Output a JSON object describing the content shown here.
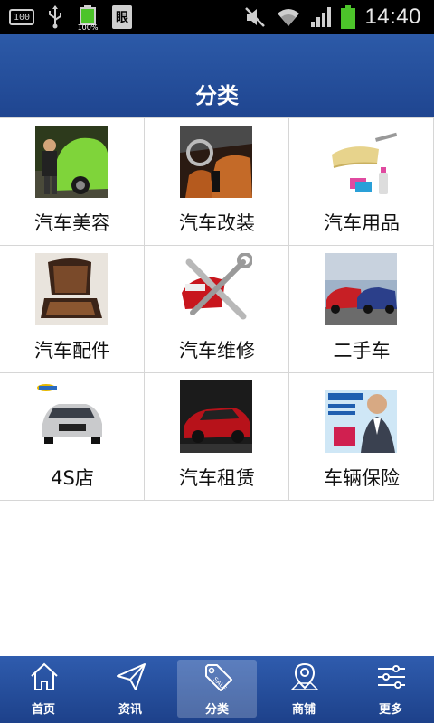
{
  "status_bar": {
    "left_box_text": "100",
    "battery_small_pct": "100%",
    "doc_icon_char": "眼",
    "time": "14:40",
    "icons": [
      "screenshot-icon",
      "usb-icon",
      "battery-charging-icon",
      "document-icon",
      "mute-icon",
      "wifi-icon",
      "signal-icon",
      "battery-icon"
    ]
  },
  "header": {
    "title": "分类"
  },
  "categories": [
    {
      "label": "汽车美容",
      "icon": "car-wash-thumbnail"
    },
    {
      "label": "汽车改装",
      "icon": "car-interior-thumbnail"
    },
    {
      "label": "汽车用品",
      "icon": "car-duster-thumbnail"
    },
    {
      "label": "汽车配件",
      "icon": "car-seat-thumbnail"
    },
    {
      "label": "汽车维修",
      "icon": "car-repair-thumbnail"
    },
    {
      "label": "二手车",
      "icon": "used-cars-thumbnail"
    },
    {
      "label": "4S店",
      "icon": "audi-car-thumbnail"
    },
    {
      "label": "汽车租赁",
      "icon": "red-suv-thumbnail"
    },
    {
      "label": "车辆保险",
      "icon": "insurance-ad-thumbnail"
    }
  ],
  "bottom_nav": {
    "items": [
      {
        "label": "首页",
        "icon": "home-icon"
      },
      {
        "label": "资讯",
        "icon": "paper-plane-icon"
      },
      {
        "label": "分类",
        "icon": "sale-tag-icon"
      },
      {
        "label": "商铺",
        "icon": "map-pin-icon"
      },
      {
        "label": "更多",
        "icon": "sliders-icon"
      }
    ],
    "active_index": 2
  },
  "colors": {
    "header_blue": "#1f4590",
    "nav_blue": "#1d418a",
    "grid_line": "#d6d6d6",
    "battery_green": "#4cc42a"
  }
}
